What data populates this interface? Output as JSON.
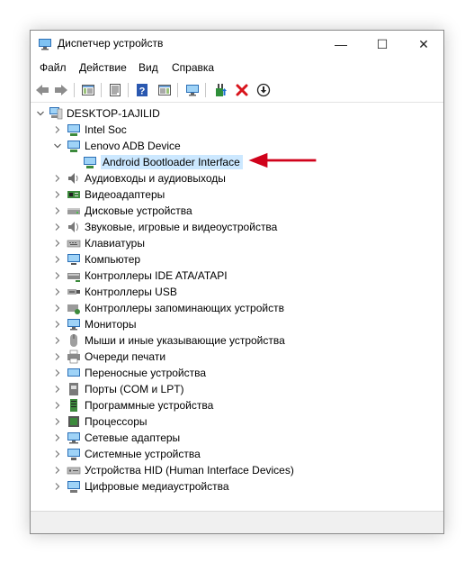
{
  "window": {
    "title": "Диспетчер устройств",
    "buttons": {
      "minimize": "—",
      "maximize": "☐",
      "close": "✕"
    }
  },
  "menu": [
    "Файл",
    "Действие",
    "Вид",
    "Справка"
  ],
  "toolbar": {
    "icons": [
      "back-icon",
      "forward-icon",
      "show-hide-tree-icon",
      "properties-icon",
      "help-icon",
      "action-pane-icon",
      "monitor-icon",
      "update-driver-icon",
      "uninstall-icon",
      "download-icon"
    ]
  },
  "tree": {
    "root": "DESKTOP-1AJILID",
    "items": [
      "Intel Soc",
      "Lenovo ADB Device",
      "Android Bootloader Interface",
      "Аудиовходы и аудиовыходы",
      "Видеоадаптеры",
      "Дисковые устройства",
      "Звуковые, игровые и видеоустройства",
      "Клавиатуры",
      "Компьютер",
      "Контроллеры IDE ATA/ATAPI",
      "Контроллеры USB",
      "Контроллеры запоминающих устройств",
      "Мониторы",
      "Мыши и иные указывающие устройства",
      "Очереди печати",
      "Переносные устройства",
      "Порты (COM и LPT)",
      "Программные устройства",
      "Процессоры",
      "Сетевые адаптеры",
      "Системные устройства",
      "Устройства HID (Human Interface Devices)",
      "Цифровые медиаустройства"
    ]
  },
  "colors": {
    "selection": "#cce8ff",
    "annotation_arrow": "#d0021b"
  }
}
